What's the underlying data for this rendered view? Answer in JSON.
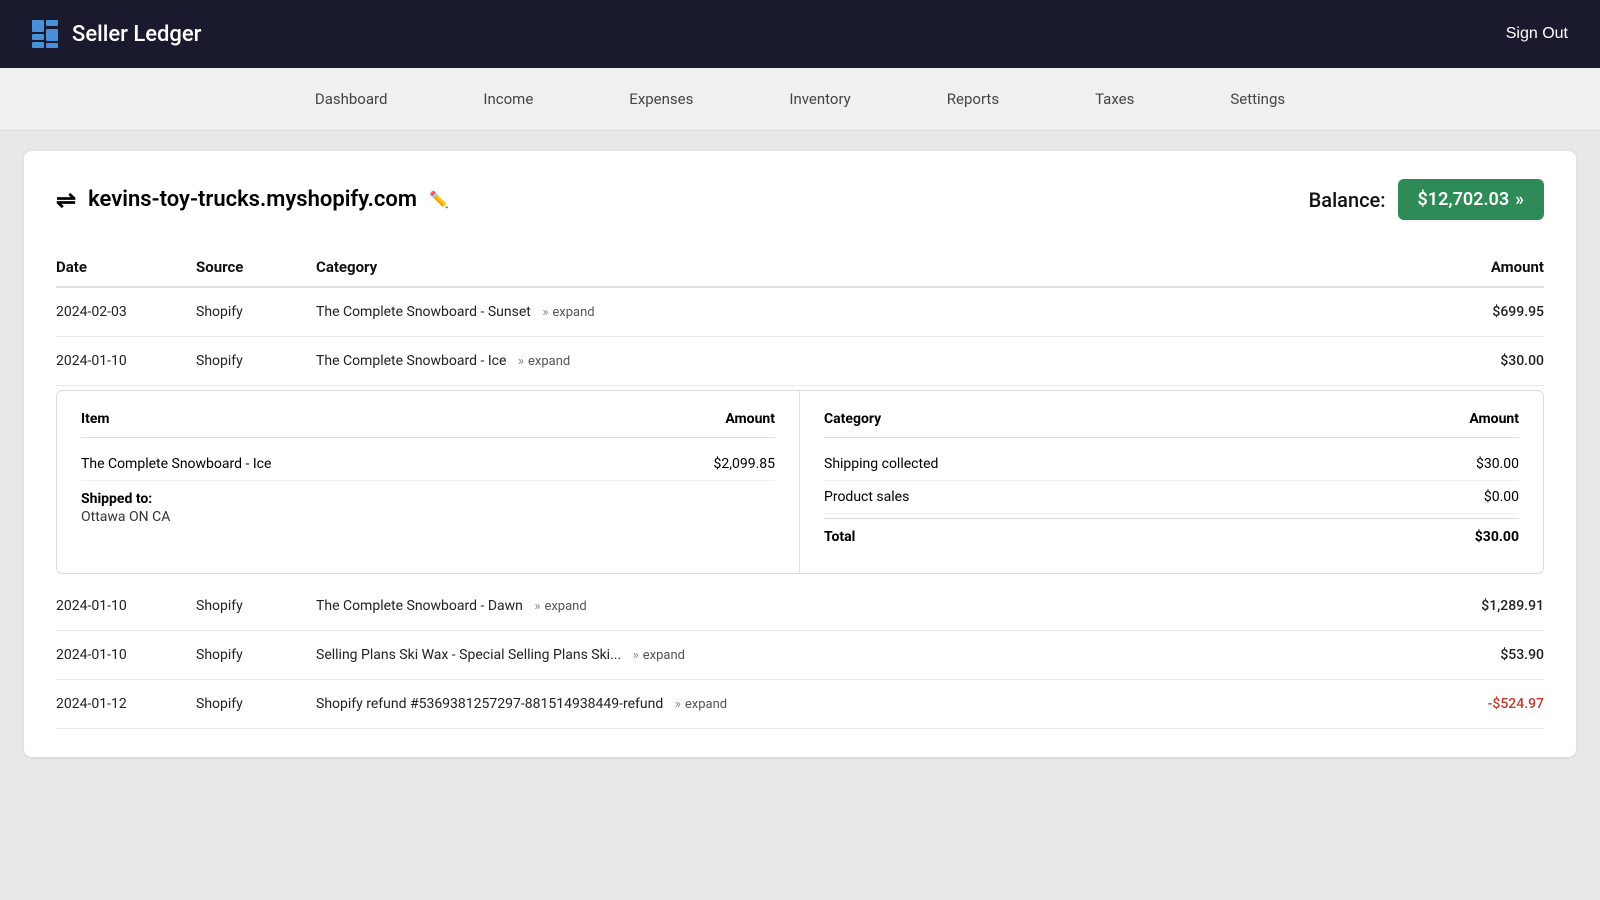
{
  "app": {
    "name": "Seller Ledger",
    "sign_out": "Sign Out"
  },
  "nav": {
    "items": [
      {
        "label": "Dashboard",
        "id": "dashboard"
      },
      {
        "label": "Income",
        "id": "income"
      },
      {
        "label": "Expenses",
        "id": "expenses"
      },
      {
        "label": "Inventory",
        "id": "inventory"
      },
      {
        "label": "Reports",
        "id": "reports"
      },
      {
        "label": "Taxes",
        "id": "taxes"
      },
      {
        "label": "Settings",
        "id": "settings"
      }
    ]
  },
  "account": {
    "name": "kevins-toy-trucks.myshopify.com",
    "balance_label": "Balance:",
    "balance_value": "$12,702.03"
  },
  "table": {
    "columns": {
      "date": "Date",
      "source": "Source",
      "category": "Category",
      "amount": "Amount"
    }
  },
  "transactions": [
    {
      "id": "tx1",
      "date": "2024-02-03",
      "source": "Shopify",
      "category": "The Complete Snowboard - Sunset",
      "expand_label": "expand",
      "amount": "$699.95",
      "negative": false,
      "expanded": false
    },
    {
      "id": "tx2",
      "date": "2024-01-10",
      "source": "Shopify",
      "category": "The Complete Snowboard - Ice",
      "expand_label": "expand",
      "amount": "$30.00",
      "negative": false,
      "expanded": true,
      "detail": {
        "left_headers": {
          "item": "Item",
          "amount": "Amount"
        },
        "right_headers": {
          "category": "Category",
          "amount": "Amount"
        },
        "items": [
          {
            "name": "The Complete Snowboard - Ice",
            "amount": "$2,099.85"
          }
        ],
        "shipped_label": "Shipped to:",
        "shipped_address": "Ottawa ON CA",
        "categories": [
          {
            "name": "Shipping collected",
            "amount": "$30.00"
          },
          {
            "name": "Product sales",
            "amount": "$0.00"
          }
        ],
        "total_label": "Total",
        "total_amount": "$30.00"
      }
    },
    {
      "id": "tx3",
      "date": "2024-01-10",
      "source": "Shopify",
      "category": "The Complete Snowboard - Dawn",
      "expand_label": "expand",
      "amount": "$1,289.91",
      "negative": false,
      "expanded": false
    },
    {
      "id": "tx4",
      "date": "2024-01-10",
      "source": "Shopify",
      "category": "Selling Plans Ski Wax - Special Selling Plans Ski...",
      "expand_label": "expand",
      "amount": "$53.90",
      "negative": false,
      "expanded": false
    },
    {
      "id": "tx5",
      "date": "2024-01-12",
      "source": "Shopify",
      "category": "Shopify refund #5369381257297-881514938449-refund",
      "expand_label": "expand",
      "amount": "-$524.97",
      "negative": true,
      "expanded": false
    }
  ]
}
